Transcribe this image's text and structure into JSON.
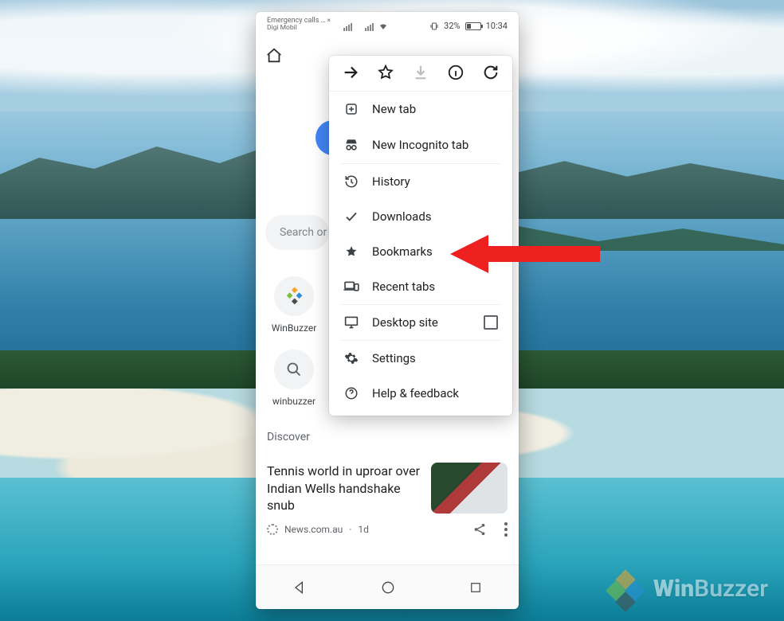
{
  "statusbar": {
    "carrier_line1": "Emergency calls …",
    "carrier_line2": "Digi Mobil",
    "battery_percent": "32%",
    "time": "10:34"
  },
  "underlay": {
    "search_placeholder": "Search or type web address",
    "tile1_label": "WinBuzzer",
    "tile2_label": "winbuzzer",
    "discover_label": "Discover",
    "news1_title": "Tennis world in uproar over Indian Wells handshake snub",
    "news1_source": "News.com.au",
    "news1_age": "1d"
  },
  "menu": {
    "new_tab": "New tab",
    "new_incognito": "New Incognito tab",
    "history": "History",
    "downloads": "Downloads",
    "bookmarks": "Bookmarks",
    "recent_tabs": "Recent tabs",
    "desktop_site": "Desktop site",
    "settings": "Settings",
    "help": "Help & feedback"
  },
  "watermark": {
    "brand_prefix": "Win",
    "brand_suffix": "Buzzer"
  }
}
